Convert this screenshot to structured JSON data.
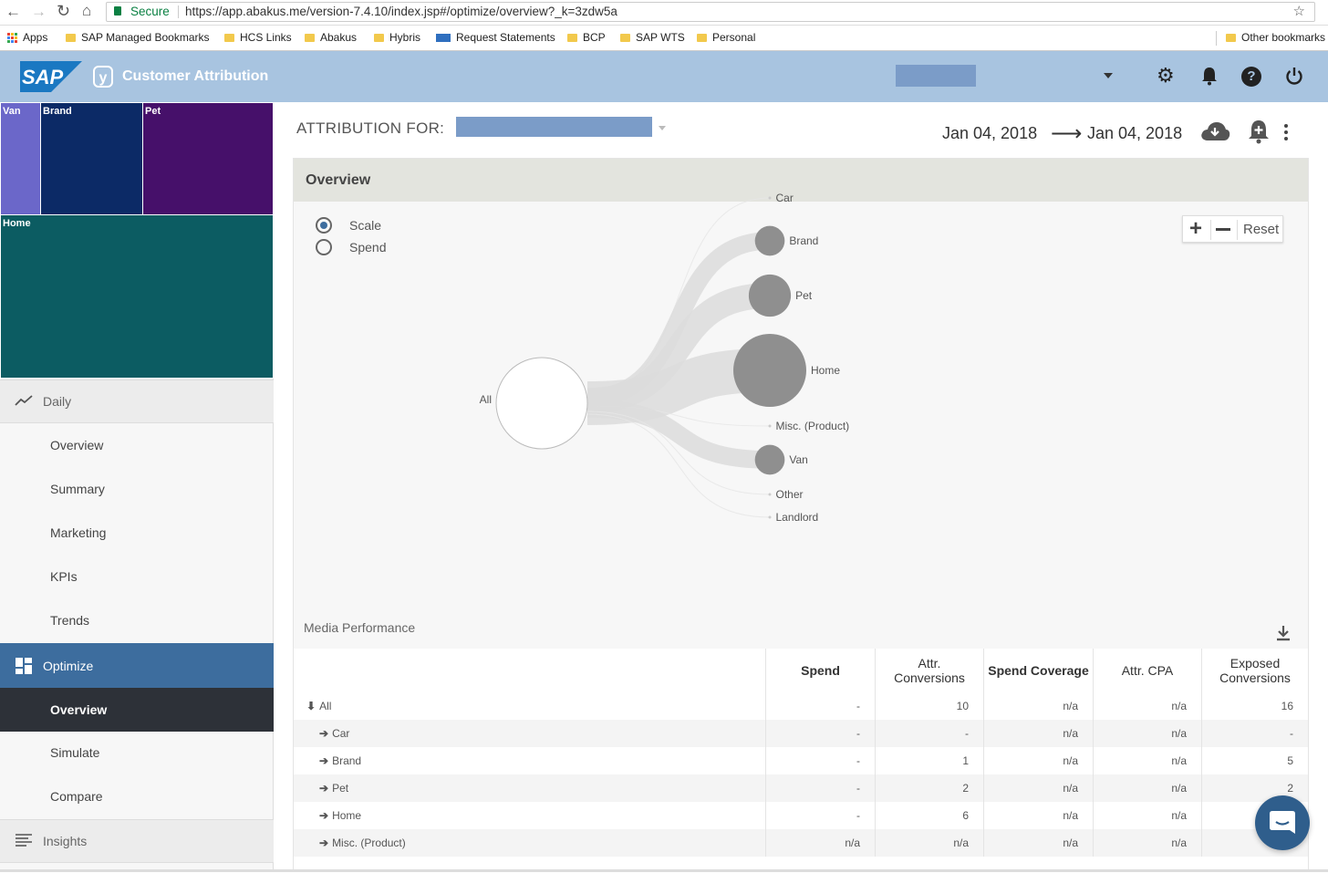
{
  "browser": {
    "secure_label": "Secure",
    "url": "https://app.abakus.me/version-7.4.10/index.jsp#/optimize/overview?_k=3zdw5a",
    "bookmarks": [
      {
        "label": "Apps",
        "icon": "apps-grid-icon"
      },
      {
        "label": "SAP Managed Bookmarks",
        "icon": "folder-icon"
      },
      {
        "label": "HCS Links",
        "icon": "folder-icon"
      },
      {
        "label": "Abakus",
        "icon": "folder-icon"
      },
      {
        "label": "Hybris",
        "icon": "folder-icon"
      },
      {
        "label": "Request Statements",
        "icon": "sap-icon"
      },
      {
        "label": "BCP",
        "icon": "folder-icon"
      },
      {
        "label": "SAP WTS",
        "icon": "folder-icon"
      },
      {
        "label": "Personal",
        "icon": "folder-icon"
      }
    ],
    "other_bookmarks": "Other bookmarks"
  },
  "app": {
    "logo_text": "SAP",
    "product_name": "Customer Attribution",
    "colors": {
      "appbar": "#a8c4e0",
      "accent": "#3d6d9e",
      "nav_active": "#2d3138"
    }
  },
  "treemap": [
    {
      "label": "Van",
      "color": "#6b67c9"
    },
    {
      "label": "Brand",
      "color": "#0c2a66"
    },
    {
      "label": "Pet",
      "color": "#46106a"
    },
    {
      "label": "Home",
      "color": "#0c5c62"
    }
  ],
  "nav": {
    "daily_label": "Daily",
    "daily_items": [
      "Overview",
      "Summary",
      "Marketing",
      "KPIs",
      "Trends"
    ],
    "optimize_label": "Optimize",
    "optimize_items": [
      "Overview",
      "Simulate",
      "Compare"
    ],
    "insights_label": "Insights"
  },
  "header": {
    "attribution_label": "ATTRIBUTION FOR:",
    "date_from": "Jan 04, 2018",
    "date_to": "Jan 04, 2018"
  },
  "overview": {
    "title": "Overview",
    "radio_scale": "Scale",
    "radio_spend": "Spend",
    "reset_label": "Reset",
    "root_label": "All",
    "nodes": [
      {
        "label": "Car",
        "value": 0
      },
      {
        "label": "Brand",
        "value": 1
      },
      {
        "label": "Pet",
        "value": 2
      },
      {
        "label": "Home",
        "value": 6
      },
      {
        "label": "Misc. (Product)",
        "value": 0
      },
      {
        "label": "Van",
        "value": 1
      },
      {
        "label": "Other",
        "value": 0
      },
      {
        "label": "Landlord",
        "value": 0
      }
    ]
  },
  "media": {
    "title": "Media Performance",
    "columns": [
      "Spend",
      "Attr. Conversions",
      "Spend Coverage",
      "Attr. CPA",
      "Exposed Conversions"
    ],
    "rows": [
      {
        "name": "All",
        "spend": "-",
        "conv": "10",
        "cov": "n/a",
        "cpa": "n/a",
        "exp": "16"
      },
      {
        "name": "Car",
        "spend": "-",
        "conv": "-",
        "cov": "n/a",
        "cpa": "n/a",
        "exp": "-"
      },
      {
        "name": "Brand",
        "spend": "-",
        "conv": "1",
        "cov": "n/a",
        "cpa": "n/a",
        "exp": "5"
      },
      {
        "name": "Pet",
        "spend": "-",
        "conv": "2",
        "cov": "n/a",
        "cpa": "n/a",
        "exp": "2"
      },
      {
        "name": "Home",
        "spend": "-",
        "conv": "6",
        "cov": "n/a",
        "cpa": "n/a",
        "exp": ""
      },
      {
        "name": "Misc. (Product)",
        "spend": "n/a",
        "conv": "n/a",
        "cov": "n/a",
        "cpa": "n/a",
        "exp": ""
      }
    ]
  }
}
